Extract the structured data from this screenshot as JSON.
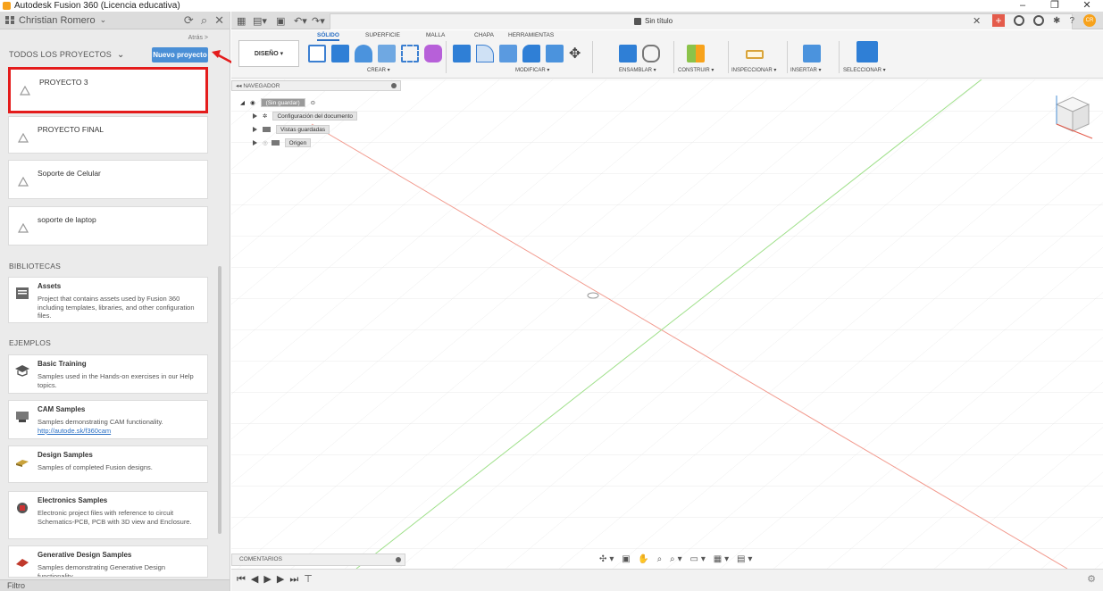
{
  "window": {
    "title": "Autodesk Fusion 360 (Licencia educativa)",
    "controls": [
      "–",
      "❐",
      "✕"
    ]
  },
  "left_panel": {
    "user": "Christian Romero",
    "back_label": "Atrás >",
    "projects_label": "TODOS LOS PROYECTOS",
    "new_project_label": "Nuevo proyecto",
    "projects": [
      {
        "name": "PROYECTO 3",
        "selected": true
      },
      {
        "name": "PROYECTO FINAL"
      },
      {
        "name": "Soporte de Celular"
      },
      {
        "name": "soporte de laptop"
      }
    ],
    "libraries_label": "BIBLIOTECAS",
    "libraries": [
      {
        "title": "Assets",
        "desc": "Project that contains assets used by Fusion 360 including templates, libraries, and other configuration files."
      }
    ],
    "examples_label": "EJEMPLOS",
    "examples": [
      {
        "title": "Basic Training",
        "desc": "Samples used in the Hands-on exercises in our Help topics.",
        "link": ""
      },
      {
        "title": "CAM Samples",
        "desc": "Samples demonstrating CAM functionality.",
        "link": "http://autode.sk/f360cam"
      },
      {
        "title": "Design Samples",
        "desc": "Samples of completed Fusion designs.",
        "link": ""
      },
      {
        "title": "Electronics Samples",
        "desc": "Electronic project files with reference to circuit Schematics-PCB, PCB with 3D view and Enclosure.",
        "link": ""
      },
      {
        "title": "Generative Design Samples",
        "desc": "Samples demonstrating Generative Design functionality.",
        "link": ""
      }
    ],
    "filter_label": "Filtro"
  },
  "document": {
    "tab_name": "Sin título",
    "avatar_initials": "CR"
  },
  "toolbar": {
    "workspace": "DISEÑO ▾",
    "tabs": [
      {
        "label": "SÓLIDO",
        "active": true
      },
      {
        "label": "SUPERFICIE"
      },
      {
        "label": "MALLA"
      },
      {
        "label": "CHAPA"
      },
      {
        "label": "HERRAMIENTAS"
      }
    ],
    "groups": [
      "CREAR ▾",
      "MODIFICAR ▾",
      "ENSAMBLAR ▾",
      "CONSTRUIR ▾",
      "INSPECCIONAR ▾",
      "INSERTAR ▾",
      "SELECCIONAR ▾"
    ]
  },
  "browser": {
    "title": "NAVEGADOR",
    "root": "(Sin guardar)",
    "items": [
      "Configuración del documento",
      "Vistas guardadas",
      "Origen"
    ]
  },
  "comments_label": "COMENTARIOS",
  "colors": {
    "accent": "#4a8fd6",
    "selection_highlight": "#e41c1c",
    "axis_red": "#f29b8f",
    "axis_green": "#9fe08a"
  }
}
